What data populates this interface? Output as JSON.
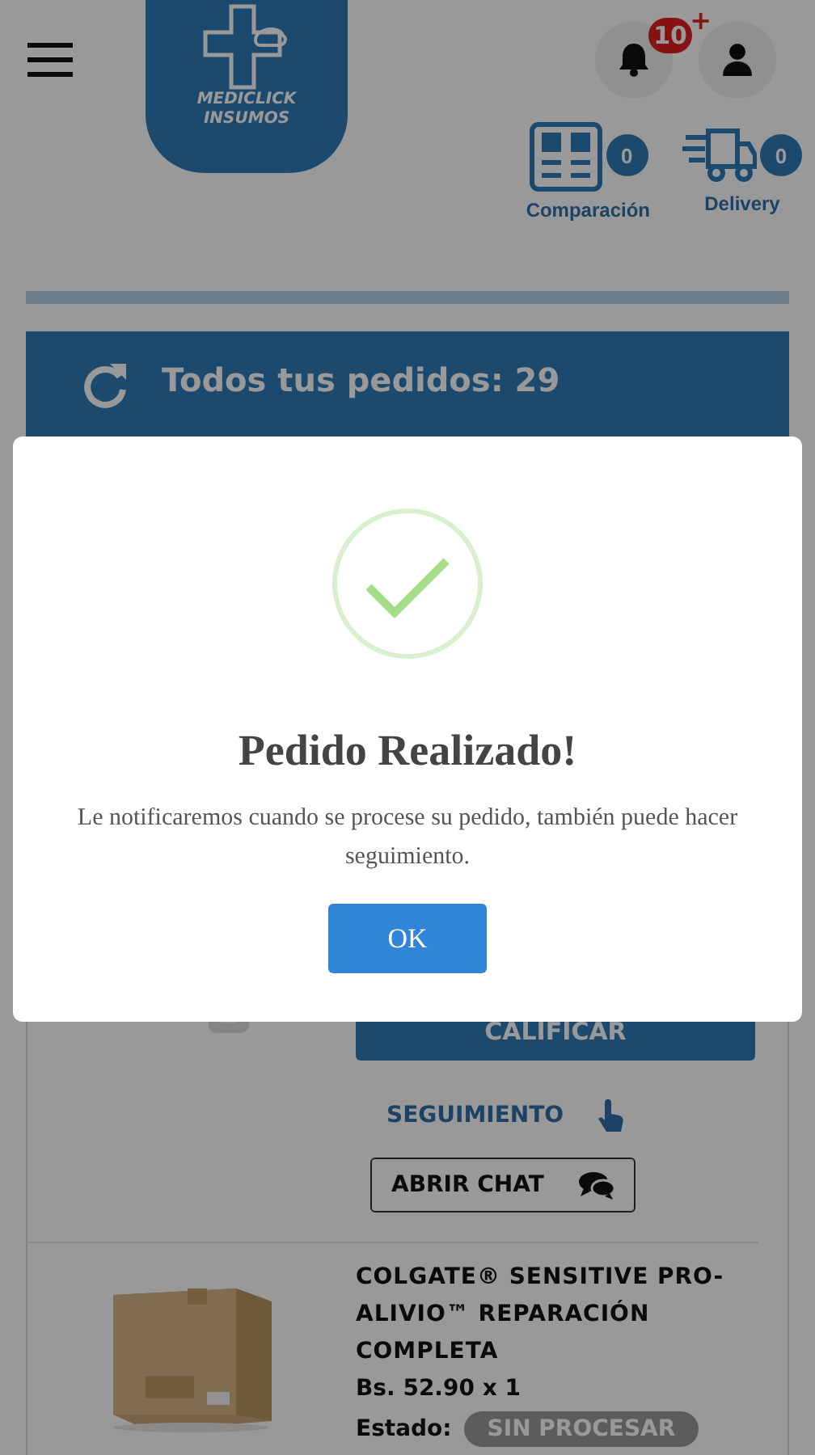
{
  "header": {
    "logo_lines": [
      "MEDICLICK",
      "INSUMOS"
    ],
    "notifications": {
      "count": "10",
      "plus": "+"
    },
    "shortcuts": [
      {
        "kind": "compare",
        "label": "Comparación",
        "count": "0"
      },
      {
        "kind": "delivery",
        "label": "Delivery",
        "count": "0"
      }
    ]
  },
  "orders_banner": {
    "title": "Todos tus pedidos: 29"
  },
  "orders": [
    {
      "kind": "partial",
      "rate_button": "CALIFICAR",
      "tracking_link": "SEGUIMIENTO",
      "chat_button": "ABRIR CHAT"
    },
    {
      "kind": "full",
      "name": "COLGATE® SENSITIVE PRO-ALIVIO™ REPARACIÓN COMPLETA",
      "price": "Bs. 52.90 x 1",
      "status_label": "Estado:",
      "status": "SIN PROCESAR"
    }
  ],
  "dialog": {
    "title": "Pedido Realizado!",
    "message": "Le notificaremos cuando se procese su pedido, también puede hacer seguimiento.",
    "button": "OK"
  }
}
